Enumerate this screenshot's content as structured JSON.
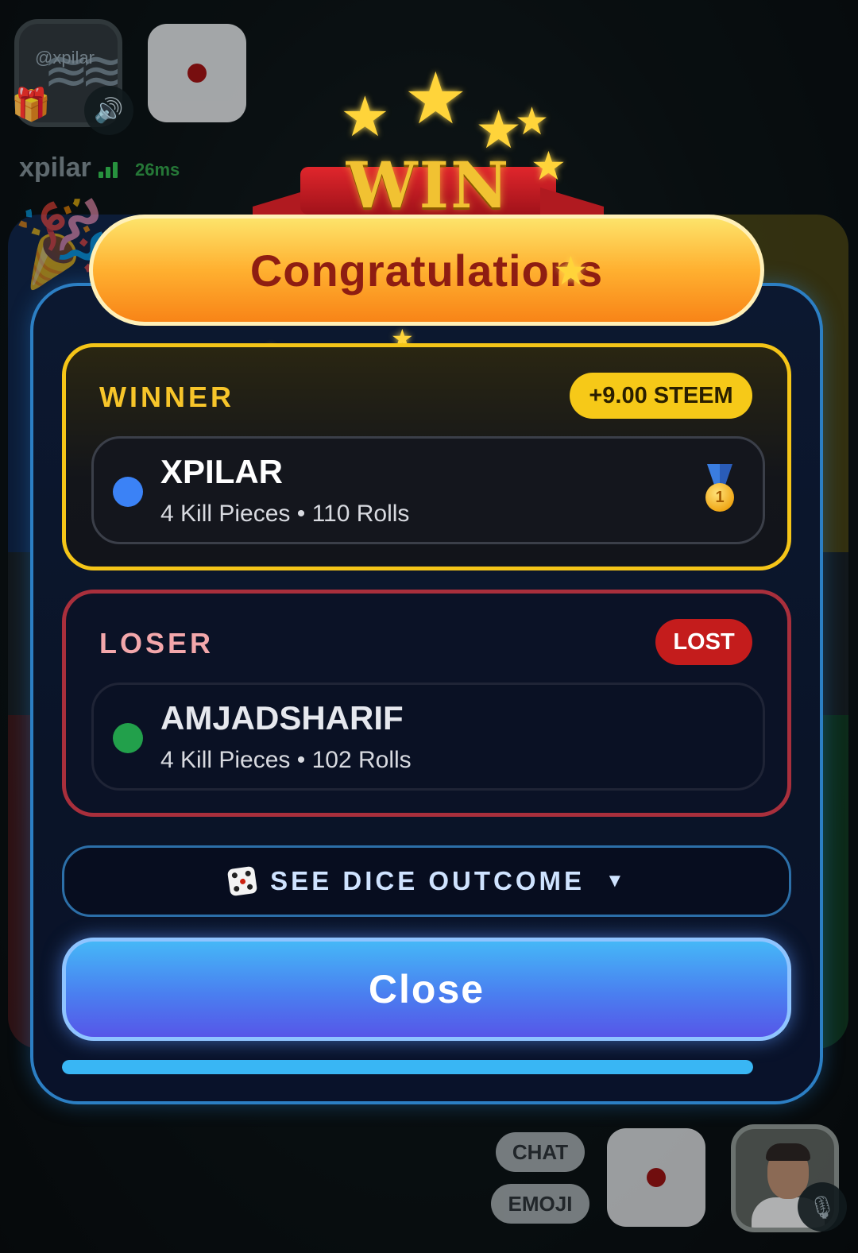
{
  "player_top": {
    "avatar_watermark": "@xpilar",
    "name": "xpilar",
    "ping": "26ms"
  },
  "controls": {
    "chat_label": "CHAT",
    "emoji_label": "EMOJI"
  },
  "modal": {
    "win_title": "WIN",
    "congrats_text": "Congratulations",
    "winner": {
      "section_label": "WINNER",
      "reward": "+9.00 STEEM",
      "player_name": "XPILAR",
      "stats": "4 Kill Pieces • 110 Rolls",
      "dot_color": "#3b82f6"
    },
    "loser": {
      "section_label": "LOSER",
      "status": "LOST",
      "player_name": "AMJADSHARIF",
      "stats": "4 Kill Pieces • 102 Rolls",
      "dot_color": "#22a04b"
    },
    "dice_outcome_label": "SEE DICE OUTCOME",
    "dice_outcome_arrow": "▼",
    "close_label": "Close",
    "progress": 1.0
  },
  "colors": {
    "accent_gold": "#f5c518",
    "loser_red": "#a92f3c",
    "close_blue": "#4a7ff0"
  }
}
